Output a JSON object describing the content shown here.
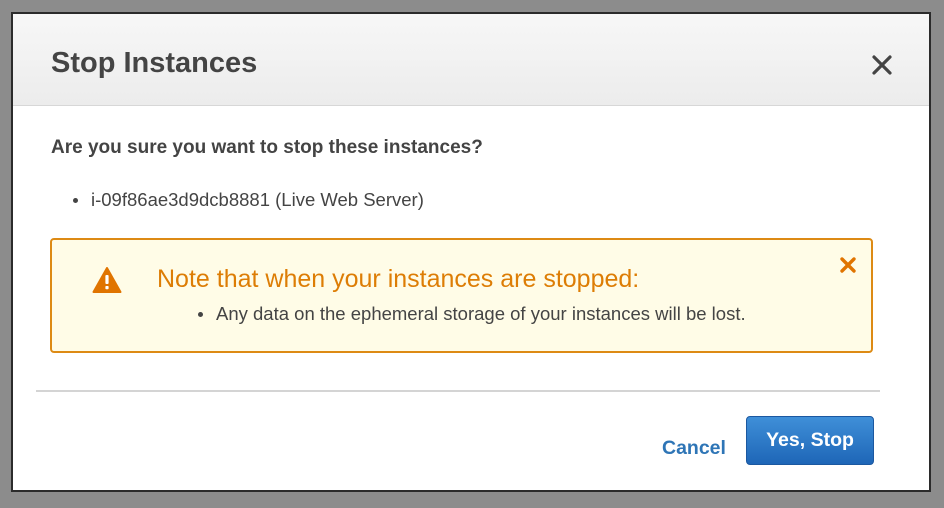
{
  "dialog": {
    "title": "Stop Instances",
    "close_icon": "close-icon"
  },
  "body": {
    "question": "Are you sure you want to stop these instances?",
    "instances": [
      "i-09f86ae3d9dcb8881 (Live Web Server)"
    ]
  },
  "warning": {
    "icon": "warning-icon",
    "title": "Note that when your instances are stopped:",
    "items": [
      "Any data on the ephemeral storage of your instances will be lost."
    ],
    "dismiss_icon": "dismiss-icon"
  },
  "footer": {
    "cancel_label": "Cancel",
    "confirm_label": "Yes, Stop"
  },
  "colors": {
    "accent": "#2e75b6",
    "warning": "#dd7d05",
    "warning_border": "#dd8a14",
    "warning_background": "#fffce7",
    "primary_button": "#1e66b7"
  }
}
